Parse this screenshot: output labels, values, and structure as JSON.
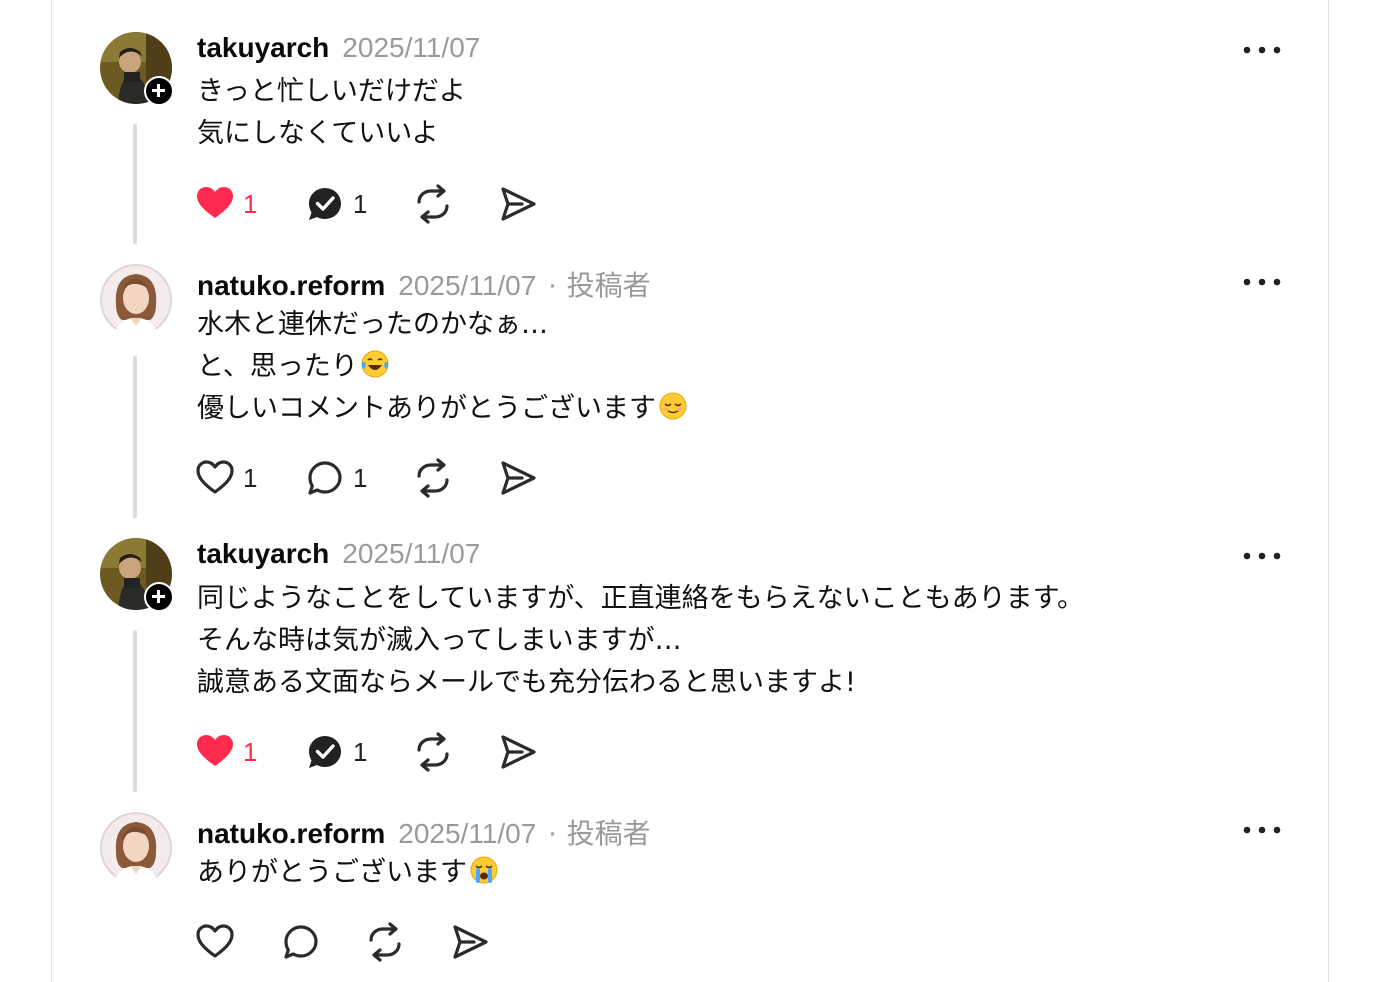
{
  "replies": [
    {
      "username": "takuyarch",
      "date": "2025/11/07",
      "role": "",
      "lines": [
        "きっと忙しいだけだよ",
        "気にしなくていいよ"
      ],
      "likes": "1",
      "comments": "1",
      "liked": true,
      "commented": true,
      "avatar_icon": "photo-avatar-man",
      "follow_badge_icon": "plus-icon"
    },
    {
      "username": "natuko.reform",
      "date": "2025/11/07",
      "separator": "·",
      "role": "投稿者",
      "lines": [
        "水木と連休だったのかなぁ…",
        "と、思ったり",
        "優しいコメントありがとうございます"
      ],
      "line_emojis": [
        "",
        "face-with-tears-of-joy",
        "relieved-face"
      ],
      "likes": "1",
      "comments": "1",
      "liked": false,
      "commented": false,
      "avatar_icon": "photo-avatar-woman"
    },
    {
      "username": "takuyarch",
      "date": "2025/11/07",
      "role": "",
      "lines": [
        "同じようなことをしていますが、正直連絡をもらえないこともあります。",
        "そんな時は気が滅入ってしまいますが…",
        "誠意ある文面ならメールでも充分伝わると思いますよ!"
      ],
      "likes": "1",
      "comments": "1",
      "liked": true,
      "commented": true,
      "avatar_icon": "photo-avatar-man",
      "follow_badge_icon": "plus-icon"
    },
    {
      "username": "natuko.reform",
      "date": "2025/11/07",
      "separator": "·",
      "role": "投稿者",
      "lines": [
        "ありがとうございます"
      ],
      "line_emojis": [
        "loudly-crying-face"
      ],
      "likes": "",
      "comments": "",
      "liked": false,
      "commented": false,
      "avatar_icon": "photo-avatar-woman"
    }
  ],
  "icons": {
    "like": "heart-icon",
    "comment": "speech-bubble-icon",
    "repost": "repost-icon",
    "share": "send-icon",
    "more": "more-horizontal-icon"
  },
  "colors": {
    "like_active": "#ff2b4f",
    "secondary_text": "#9a9a9a",
    "thread_line": "#dcdcdc"
  }
}
